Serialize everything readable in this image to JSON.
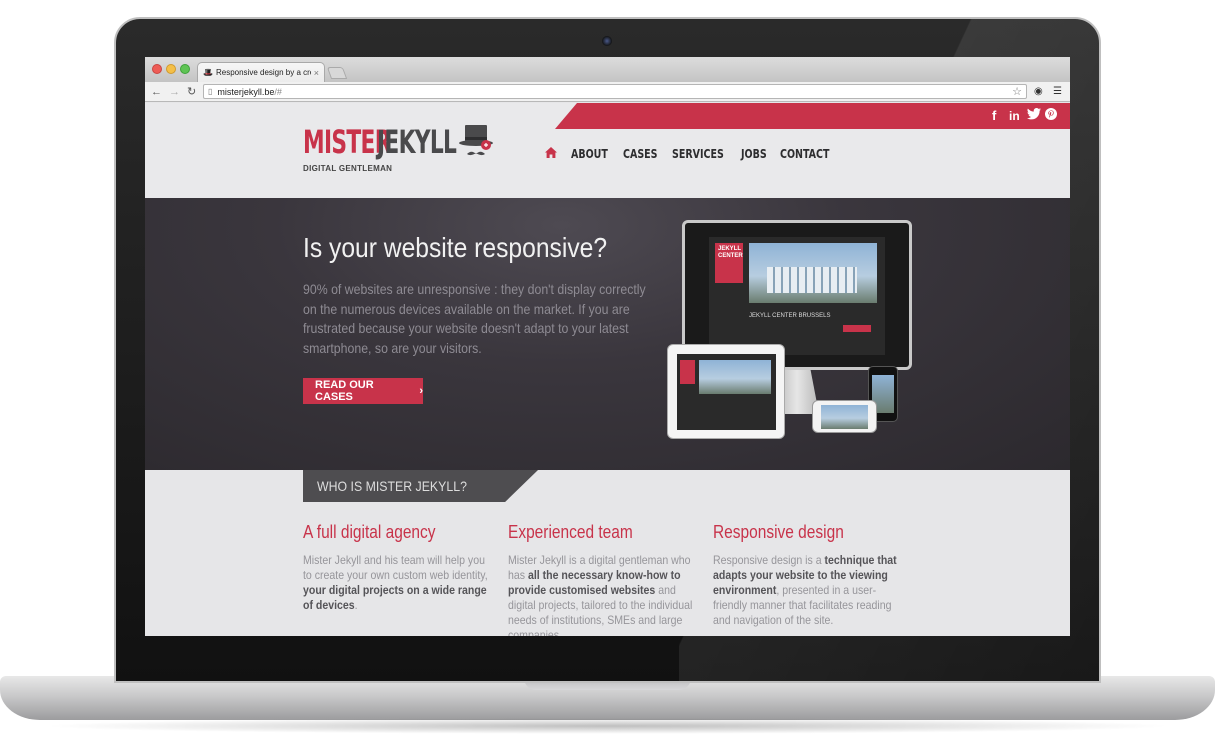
{
  "browser": {
    "tab_title": "Responsive design by a crea",
    "tab_close": "×",
    "url_host": "misterjekyll.be",
    "url_path": "/#"
  },
  "site": {
    "logo": {
      "mister": "MISTER",
      "jekyll": "JEKYLL",
      "tagline": "DIGITAL GENTLEMAN"
    },
    "social": [
      "f",
      "in"
    ],
    "nav": [
      "ABOUT",
      "CASES",
      "SERVICES",
      "JOBS",
      "CONTACT"
    ],
    "hero": {
      "title": "Is your website responsive?",
      "text": "90% of websites are unresponsive : they don't display correctly on the numerous devices available on the market. If you are frustrated because your website doesn't adapt to your latest smartphone, so are your visitors.",
      "button": "READ OUR CASES",
      "button_arrow": "›",
      "device_label": "JEKYLL CENTER",
      "device_caption": "JEKYLL CENTER BRUSSELS"
    },
    "who": {
      "banner": "WHO IS MISTER JEKYLL?",
      "col1": {
        "title": "A full digital agency",
        "text_a": "Mister Jekyll and his team will help you to create your own custom web identity, ",
        "text_b": "your digital projects on a wide range of devices",
        "text_c": "."
      },
      "col2": {
        "title": "Experienced team",
        "text_a": "Mister Jekyll is a digital gentleman who has ",
        "text_b": "all the necessary know-how to provide customised websites",
        "text_c": " and digital projects, tailored to the individual needs of institutions, SMEs and large companies."
      },
      "col3": {
        "title": "Responsive design",
        "text_a": "Responsive design is a ",
        "text_b": "technique that adapts your website to the viewing environment",
        "text_c": ", presented in a user-friendly manner that facilitates reading and navigation of the site."
      }
    }
  },
  "colors": {
    "brand_red": "#c8334a",
    "hero_bg": "#3a363d"
  },
  "icons": [
    "home-icon",
    "facebook-icon",
    "linkedin-icon",
    "twitter-icon",
    "pinterest-icon",
    "star-icon",
    "menu-icon",
    "back-icon",
    "forward-icon",
    "reload-icon"
  ]
}
